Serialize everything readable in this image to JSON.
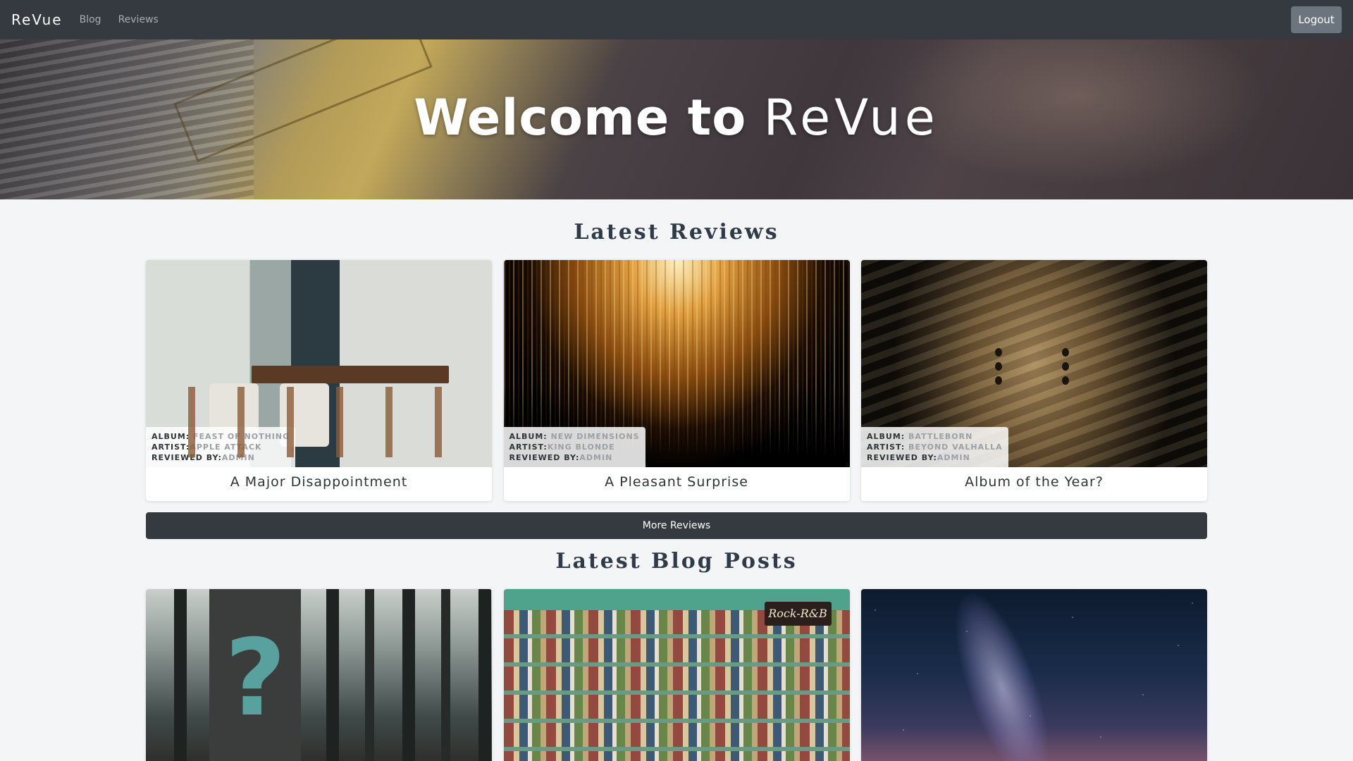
{
  "nav": {
    "brand": "ReVue",
    "links": [
      "Blog",
      "Reviews"
    ],
    "logout_label": "Logout"
  },
  "hero": {
    "title_strong": "Welcome to",
    "title_light": "ReVue"
  },
  "reviews_section": {
    "title": "Latest Reviews",
    "album_label": "ALBUM:",
    "artist_label": "ARTIST:",
    "reviewer_label": "REVIEWED BY:",
    "cards": [
      {
        "title": "A Major Disappointment",
        "album": "FEAST OF NOTHING",
        "artist": "APPLE ATTACK",
        "reviewer": "ADMIN",
        "image": "dining-room"
      },
      {
        "title": "A Pleasant Surprise",
        "album": "NEW DIMENSIONS",
        "artist": "KING BLONDE",
        "reviewer": "ADMIN",
        "image": "golden-chandelier"
      },
      {
        "title": "Album of the Year?",
        "album": "BATTLEBORN",
        "artist": "BEYOND VALHALLA",
        "reviewer": "ADMIN",
        "image": "armor"
      }
    ],
    "more_label": "More Reviews"
  },
  "blog_section": {
    "title": "Latest Blog Posts",
    "cards": [
      {
        "image": "forest-question-mark"
      },
      {
        "image": "record-store",
        "sign_text": "Rock-R&B"
      },
      {
        "image": "milky-way"
      }
    ]
  },
  "colors": {
    "navbar": "#343a40",
    "nav_link": "#a9adb1",
    "logout_button": "#6c757d",
    "section_title": "#2f3b48",
    "page_bg": "#f4f5f7",
    "meta_value": "#9aa0a6"
  }
}
